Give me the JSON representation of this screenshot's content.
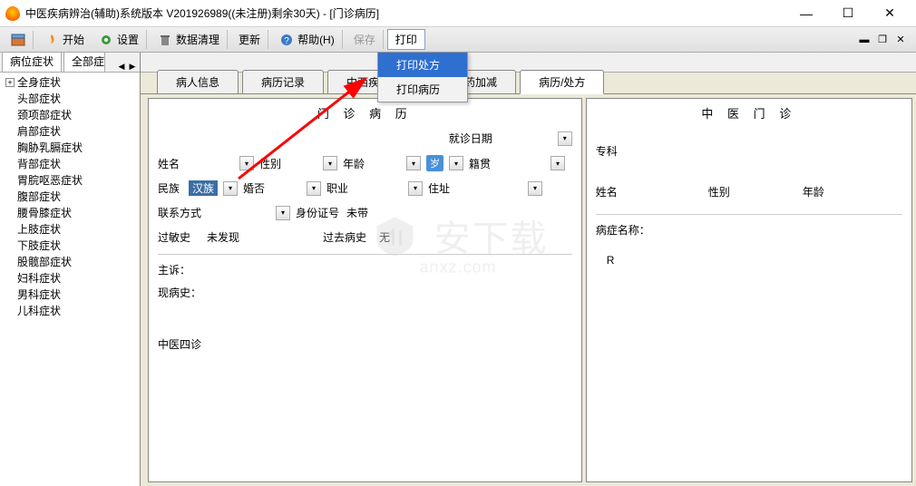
{
  "window": {
    "title": "中医疾病辨治(辅助)系统版本 V201926989((未注册)剩余30天) - [门诊病历]"
  },
  "toolbar": {
    "start": "开始",
    "settings": "设置",
    "clean": "数据清理",
    "update": "更新",
    "help": "帮助(H)",
    "save": "保存",
    "print": "打印"
  },
  "print_menu": {
    "rx": "打印处方",
    "record": "打印病历"
  },
  "sidebar": {
    "tab1": "病位症状",
    "tab2": "全部症",
    "items": [
      "全身症状",
      "头部症状",
      "颈项部症状",
      "肩部症状",
      "胸胁乳膈症状",
      "背部症状",
      "胃脘呕恶症状",
      "腹部症状",
      "腰骨膝症状",
      "上肢症状",
      "下肢症状",
      "股髋部症状",
      "妇科症状",
      "男科症状",
      "儿科症状"
    ]
  },
  "content_tabs": {
    "t1": "病人信息",
    "t2": "病历记录",
    "t3": "中西疾病",
    "t4": "证型方药加减",
    "t5": "病历/处方"
  },
  "left_panel": {
    "title": "门 诊 病 历",
    "visit_date": "就诊日期",
    "name": "姓名",
    "gender": "性别",
    "age": "年龄",
    "age_unit": "岁",
    "native": "籍贯",
    "ethnic": "民族",
    "ethnic_val": "汉族",
    "marriage": "婚否",
    "job": "职业",
    "address": "住址",
    "contact": "联系方式",
    "id_no": "身份证号",
    "id_val": "未带",
    "allergy": "过敏史",
    "allergy_val": "未发现",
    "past": "过去病史",
    "past_val": "无",
    "chief": "主诉：",
    "present": "现病史：",
    "tcm_exam": "中医四诊"
  },
  "right_panel": {
    "title": "中 医 门 诊",
    "dept": "专科",
    "name": "姓名",
    "gender": "性别",
    "age": "年龄",
    "disease": "病症名称：",
    "rx": "R"
  },
  "watermark": "安下载 anxz.com"
}
